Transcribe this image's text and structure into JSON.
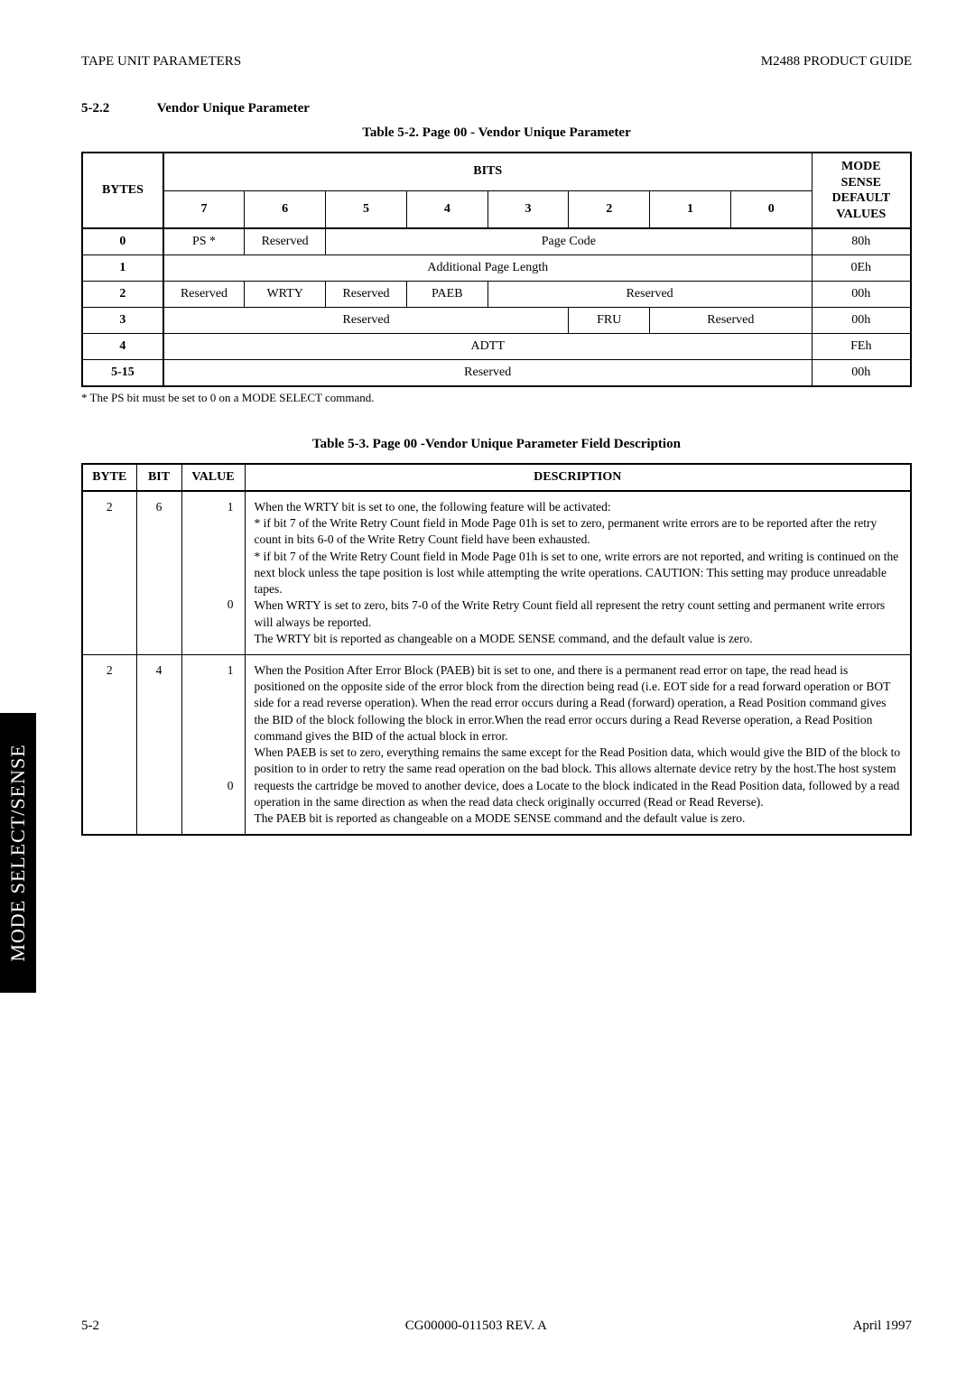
{
  "header": {
    "left": "TAPE UNIT PARAMETERS",
    "right": "M2488 PRODUCT GUIDE"
  },
  "section": {
    "num": "5-2.2",
    "title": "Vendor Unique Parameter"
  },
  "table1": {
    "caption": "Table 5-2.   Page 00 - Vendor Unique Parameter",
    "bits_header": "BITS",
    "bytes_header": "BYTES",
    "mode_header1": "MODE",
    "mode_header2": "SENSE",
    "mode_header3": "DEFAULT",
    "mode_header4": "VALUES",
    "cols": [
      "7",
      "6",
      "5",
      "4",
      "3",
      "2",
      "1",
      "0"
    ],
    "rows": [
      {
        "byte": "0",
        "cells": [
          "PS *",
          "Reserved",
          "Page Code"
        ],
        "val": "80h"
      },
      {
        "byte": "1",
        "cells": [
          "Additional Page Length"
        ],
        "val": "0Eh"
      },
      {
        "byte": "2",
        "cells": [
          "Reserved",
          "WRTY",
          "Reserved",
          "PAEB",
          "Reserved"
        ],
        "val": "00h"
      },
      {
        "byte": "3",
        "cells": [
          "Reserved",
          "FRU",
          "Reserved"
        ],
        "val": "00h"
      },
      {
        "byte": "4",
        "cells": [
          "ADTT"
        ],
        "val": "FEh"
      },
      {
        "byte": "5-15",
        "cells": [
          "Reserved"
        ],
        "val": "00h"
      }
    ],
    "note": "* The PS bit must be set to 0 on a MODE SELECT command."
  },
  "table2": {
    "caption": "Table 5-3.   Page 00 -Vendor Unique Parameter Field Description",
    "headers": {
      "byte": "BYTE",
      "bit": "BIT",
      "value": "VALUE",
      "desc": "DESCRIPTION"
    },
    "rows": [
      {
        "byte": "2",
        "bit": "6",
        "v1": "1",
        "v0": "0",
        "desc": "When the WRTY bit is set to one, the following feature will be activated:\n* if bit 7 of the Write Retry Count field in Mode Page 01h is set to zero, permanent write errors are to be reported after the retry count in bits 6-0 of the Write Retry Count field have been exhausted.\n* if bit 7 of the Write Retry Count field in Mode Page 01h is set to one, write errors are not reported, and writing is continued on the next block unless the tape position is lost while attempting the write operations. CAUTION: This setting may produce unreadable tapes.\nWhen WRTY is set to zero, bits 7-0 of the Write Retry Count field all represent the retry count setting and permanent write errors will always be reported.\nThe WRTY bit is reported as changeable on a MODE SENSE command, and the default value is zero."
      },
      {
        "byte": "2",
        "bit": "4",
        "v1": "1",
        "v0": "0",
        "desc": "When the Position After Error Block (PAEB) bit is set to one, and there is a permanent read error on tape, the read head is positioned on the opposite side of the error block from the direction being read (i.e. EOT side for a read forward operation or BOT side for a read reverse operation). When the read error occurs during a Read (forward) operation, a Read Position command gives the BID of the block following the block in error.When the read error occurs during a Read Reverse operation, a Read Position command gives the BID of the actual block in error.\nWhen PAEB is set to zero, everything remains the same except for the Read Position data, which would give the BID of the block to position to in order to retry the same read operation on the bad block. This allows alternate device retry by the host.The host system requests the cartridge be moved to another device, does a Locate to the block indicated in the Read Position data, followed by a read operation in the same direction as when the read data check originally occurred (Read or Read Reverse).\nThe PAEB bit is reported as changeable on a MODE SENSE command and the default value is zero."
      }
    ]
  },
  "sidebar": "MODE SELECT/SENSE",
  "footer": {
    "left": "5-2",
    "center": "CG00000-011503 REV. A",
    "right": "April 1997"
  },
  "chart_data": [
    {
      "type": "table",
      "title": "Table 5-2. Page 00 - Vendor Unique Parameter",
      "columns": [
        "BYTES",
        "Bit7",
        "Bit6",
        "Bit5",
        "Bit4",
        "Bit3",
        "Bit2",
        "Bit1",
        "Bit0",
        "MODE SENSE DEFAULT VALUES"
      ],
      "rows": [
        [
          "0",
          "PS *",
          "Reserved",
          "Page Code",
          "Page Code",
          "Page Code",
          "Page Code",
          "Page Code",
          "Page Code",
          "80h"
        ],
        [
          "1",
          "Additional Page Length",
          "Additional Page Length",
          "Additional Page Length",
          "Additional Page Length",
          "Additional Page Length",
          "Additional Page Length",
          "Additional Page Length",
          "Additional Page Length",
          "0Eh"
        ],
        [
          "2",
          "Reserved",
          "WRTY",
          "Reserved",
          "PAEB",
          "Reserved",
          "Reserved",
          "Reserved",
          "Reserved",
          "00h"
        ],
        [
          "3",
          "Reserved",
          "Reserved",
          "Reserved",
          "Reserved",
          "Reserved",
          "FRU",
          "Reserved",
          "Reserved",
          "00h"
        ],
        [
          "4",
          "ADTT",
          "ADTT",
          "ADTT",
          "ADTT",
          "ADTT",
          "ADTT",
          "ADTT",
          "ADTT",
          "FEh"
        ],
        [
          "5-15",
          "Reserved",
          "Reserved",
          "Reserved",
          "Reserved",
          "Reserved",
          "Reserved",
          "Reserved",
          "Reserved",
          "00h"
        ]
      ]
    },
    {
      "type": "table",
      "title": "Table 5-3. Page 00 - Vendor Unique Parameter Field Description",
      "columns": [
        "BYTE",
        "BIT",
        "VALUE",
        "DESCRIPTION"
      ],
      "rows": [
        [
          "2",
          "6",
          "1 / 0",
          "WRTY bit behavior: value 1 activates write-retry feature per Write Retry Count field bit 7; value 0 means bits 7-0 represent retry count and permanent write errors always reported. Reported changeable on MODE SENSE; default zero."
        ],
        [
          "2",
          "4",
          "1 / 0",
          "PAEB bit behavior: value 1 positions read head opposite side of error block and Read Position gives BID of following/actual block; value 0 same except Read Position gives BID to retry, enabling alternate device retry. Reported changeable on MODE SENSE; default zero."
        ]
      ]
    }
  ]
}
